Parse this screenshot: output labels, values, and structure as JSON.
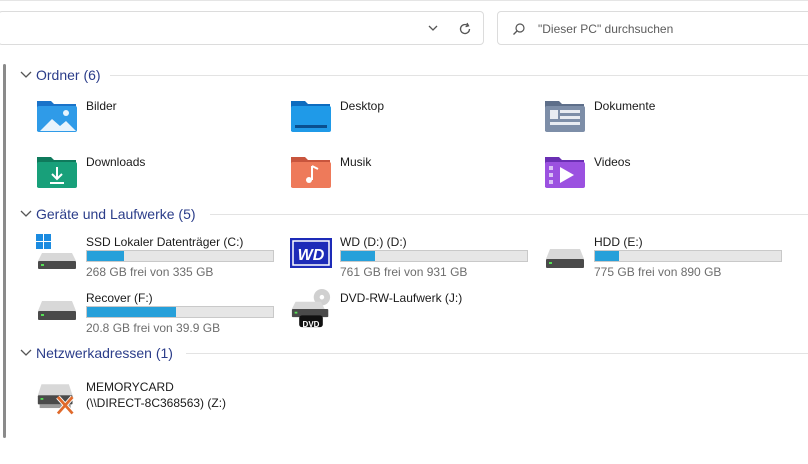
{
  "addressbar": {
    "chevron_icon": "chevron-down-icon",
    "refresh_icon": "refresh-icon"
  },
  "search": {
    "placeholder": "\"Dieser PC\" durchsuchen",
    "icon": "search-icon"
  },
  "sections": {
    "folders": {
      "title": "Ordner (6)"
    },
    "drives": {
      "title": "Geräte und Laufwerke (5)"
    },
    "network": {
      "title": "Netzwerkadressen (1)"
    }
  },
  "folders": [
    {
      "label": "Bilder",
      "icon": "pictures-folder-icon"
    },
    {
      "label": "Desktop",
      "icon": "desktop-folder-icon"
    },
    {
      "label": "Dokumente",
      "icon": "documents-folder-icon"
    },
    {
      "label": "Downloads",
      "icon": "downloads-folder-icon"
    },
    {
      "label": "Musik",
      "icon": "music-folder-icon"
    },
    {
      "label": "Videos",
      "icon": "videos-folder-icon"
    }
  ],
  "drives": [
    {
      "label": "SSD Lokaler Datenträger (C:)",
      "free_text": "268 GB frei von 335 GB",
      "used_fraction": 0.2,
      "icon": "windows-drive-icon"
    },
    {
      "label": "WD (D:) (D:)",
      "free_text": "761 GB frei von 931 GB",
      "used_fraction": 0.183,
      "icon": "wd-drive-icon"
    },
    {
      "label": "HDD (E:)",
      "free_text": "775 GB frei von 890 GB",
      "used_fraction": 0.129,
      "icon": "hard-drive-icon"
    },
    {
      "label": "Recover (F:)",
      "free_text": "20.8 GB frei von 39.9 GB",
      "used_fraction": 0.479,
      "icon": "hard-drive-icon"
    },
    {
      "label": "DVD-RW-Laufwerk (J:)",
      "icon": "dvd-drive-icon",
      "badge": "DVD"
    }
  ],
  "network": [
    {
      "line1": "MEMORYCARD",
      "line2": "(\\\\DIRECT-8C368563) (Z:)",
      "icon": "disconnected-network-drive-icon"
    }
  ],
  "colors": {
    "section_title": "#2b3d8a",
    "progress_fill": "#26a0da",
    "progress_track": "#e6e6e6"
  }
}
